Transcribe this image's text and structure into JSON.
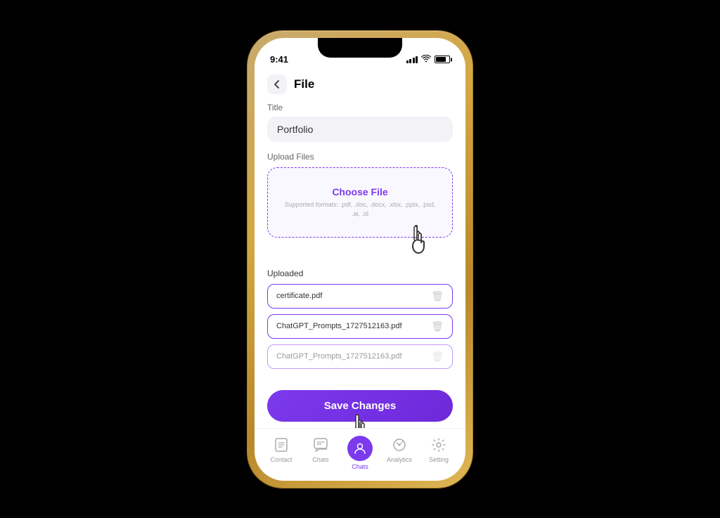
{
  "device": {
    "time": "9:41"
  },
  "header": {
    "back_label": "‹",
    "title": "File"
  },
  "form": {
    "title_label": "Title",
    "title_value": "Portfolio",
    "upload_label": "Upload Files",
    "choose_file_text": "Choose File",
    "supported_formats": "Supported formats: .pdf, .doc, .docx, .xlsx, .pptx, .psd, .ai, .id",
    "uploaded_label": "Uploaded",
    "files": [
      {
        "name": "certificate.pdf"
      },
      {
        "name": "ChatGPT_Prompts_1727512163.pdf"
      },
      {
        "name": "ChatGPT_Prompts_1727512163.pdf"
      }
    ],
    "save_button": "Save Changes"
  },
  "bottom_nav": {
    "items": [
      {
        "label": "Contact",
        "icon": "contact-icon",
        "active": false
      },
      {
        "label": "Chats",
        "icon": "chats-icon",
        "active": false
      },
      {
        "label": "Chats",
        "icon": "chats-icon-2",
        "active": true
      },
      {
        "label": "Analytics",
        "icon": "analytics-icon",
        "active": false
      },
      {
        "label": "Setting",
        "icon": "setting-icon",
        "active": false
      }
    ]
  }
}
